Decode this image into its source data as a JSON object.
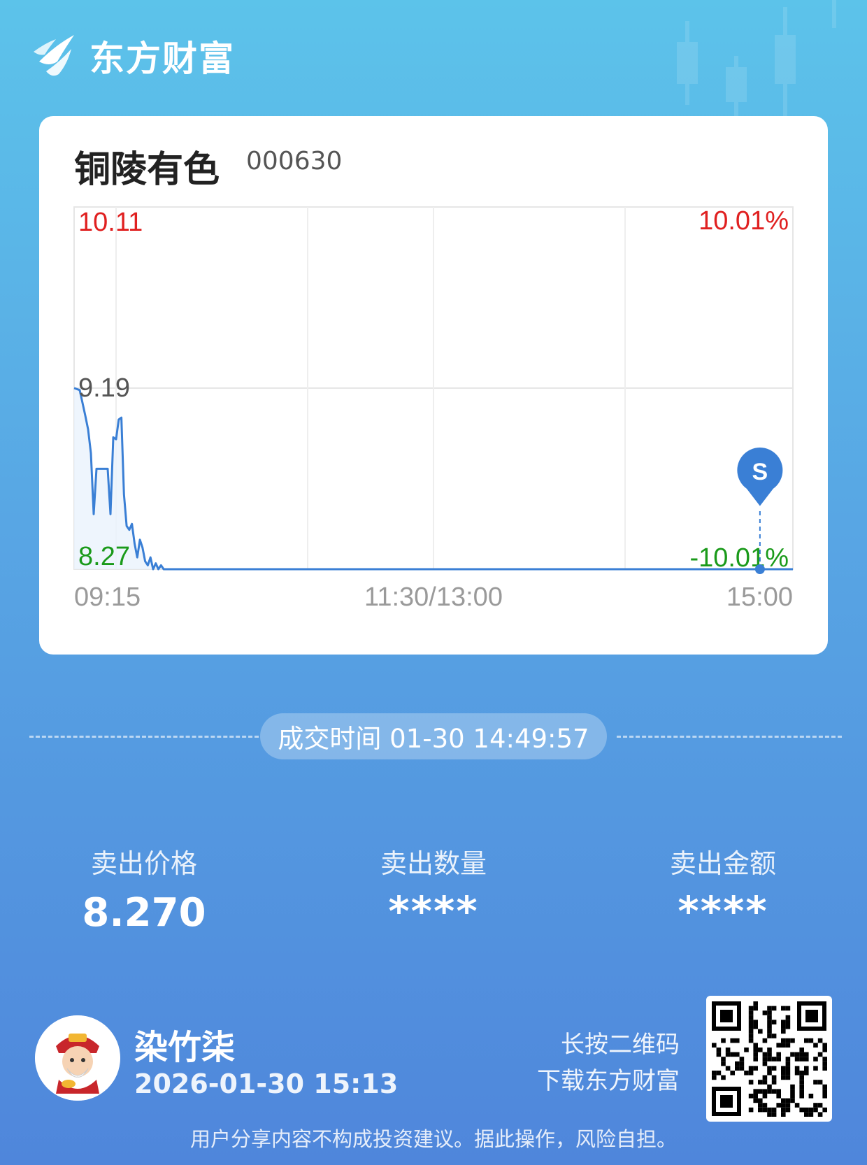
{
  "brand": {
    "name": "东方财富"
  },
  "stock": {
    "name": "铜陵有色",
    "code": "000630"
  },
  "chart_data": {
    "type": "line",
    "x": [
      "09:15",
      "09:17",
      "09:19",
      "09:20",
      "09:21",
      "09:22",
      "09:23",
      "09:25",
      "09:26",
      "09:27",
      "09:28",
      "09:29",
      "09:30",
      "09:31",
      "09:32",
      "09:33",
      "09:34",
      "09:35",
      "09:36",
      "09:37",
      "09:38",
      "09:39",
      "09:40",
      "09:41",
      "09:42",
      "09:43",
      "09:44",
      "09:45",
      "09:46",
      "09:47",
      "09:48",
      "09:50",
      "09:55",
      "10:00",
      "15:00"
    ],
    "values": [
      9.19,
      9.18,
      9.05,
      8.98,
      8.86,
      8.55,
      8.78,
      8.78,
      8.78,
      8.78,
      8.55,
      8.94,
      8.93,
      9.03,
      9.04,
      8.65,
      8.49,
      8.47,
      8.5,
      8.4,
      8.33,
      8.42,
      8.38,
      8.31,
      8.29,
      8.33,
      8.27,
      8.3,
      8.27,
      8.29,
      8.27,
      8.27,
      8.27,
      8.27,
      8.27
    ],
    "ylim": [
      8.27,
      10.11
    ],
    "y_labels": {
      "high": "10.11",
      "mid": "9.19",
      "low": "8.27"
    },
    "pct_labels": {
      "high": "10.01%",
      "low": "-10.01%"
    },
    "x_labels": [
      "09:15",
      "11:30/13:00",
      "15:00"
    ],
    "marker": {
      "label": "S",
      "time": "14:49",
      "price": 8.27
    },
    "colors": {
      "line": "#3a7fd5",
      "up": "#e02020",
      "down": "#1a9a1a",
      "mid": "#555555",
      "marker": "#3a7fd5"
    }
  },
  "trade": {
    "time_label": "成交时间 01-30 14:49:57"
  },
  "stats": [
    {
      "label": "卖出价格",
      "value": "8.270"
    },
    {
      "label": "卖出数量",
      "value": "****"
    },
    {
      "label": "卖出金额",
      "value": "****"
    }
  ],
  "user": {
    "name": "染竹柒",
    "time": "2026-01-30 15:13"
  },
  "qr_hint": {
    "line1": "长按二维码",
    "line2": "下载东方财富"
  },
  "disclaimer": "用户分享内容不构成投资建议。据此操作，风险自担。"
}
